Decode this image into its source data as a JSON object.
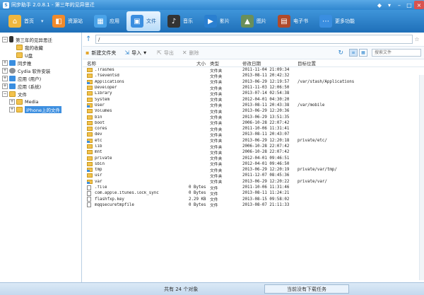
{
  "window": {
    "app_name": "同步助手 2.0.8.1",
    "device_title": "第三年的见异思迁"
  },
  "toolbar": {
    "items": [
      {
        "label": "首页",
        "icon": "home-icon",
        "color": "#f0b73f"
      },
      {
        "label": "资源站",
        "icon": "store-icon",
        "color": "#f08a2c"
      },
      {
        "label": "应用",
        "icon": "apps-icon",
        "color": "#4aa3e8"
      },
      {
        "label": "文件",
        "icon": "folder-icon",
        "color": "#3a8ee0"
      },
      {
        "label": "音乐",
        "icon": "music-icon",
        "color": "#333333"
      },
      {
        "label": "影片",
        "icon": "video-icon",
        "color": "#2a7fd0"
      },
      {
        "label": "图片",
        "icon": "picture-icon",
        "color": "#6a8f5a"
      },
      {
        "label": "电子书",
        "icon": "ebook-icon",
        "color": "#b04a2a"
      },
      {
        "label": "更多功能",
        "icon": "more-icon",
        "color": "#3a8ee0"
      }
    ],
    "active_index": 3
  },
  "sidebar": {
    "items": [
      {
        "label": "第三年的见异思迁",
        "level": 0,
        "expander": "−",
        "icon": "device"
      },
      {
        "label": "我的收藏",
        "level": 1,
        "expander": "",
        "icon": "folder"
      },
      {
        "label": "U盘",
        "level": 1,
        "expander": "",
        "icon": "folder"
      },
      {
        "label": "同步推",
        "level": 0,
        "expander": "+",
        "icon": "blue"
      },
      {
        "label": "Cydia 软件安装",
        "level": 0,
        "expander": "+",
        "icon": "gear"
      },
      {
        "label": "应用 (用户)",
        "level": 0,
        "expander": "+",
        "icon": "blue"
      },
      {
        "label": "应用 (系统)",
        "level": 0,
        "expander": "+",
        "icon": "blue"
      },
      {
        "label": "文件",
        "level": 0,
        "expander": "−",
        "icon": "folder"
      },
      {
        "label": "Media",
        "level": 1,
        "expander": "+",
        "icon": "folder"
      },
      {
        "label": "iPhone上的文件",
        "level": 1,
        "expander": "+",
        "icon": "folder",
        "selected": true
      }
    ]
  },
  "pathbar": {
    "path": "/"
  },
  "actions": {
    "new_folder": "新建文件夹",
    "import": "导入",
    "export": "导出",
    "delete": "删除",
    "search_placeholder": "搜索文件"
  },
  "table": {
    "headers": {
      "name": "名称",
      "size": "大小",
      "type": "类型",
      "date": "修改日期",
      "target": "目标位置"
    },
    "rows": [
      {
        "name": ".Trashes",
        "size": "",
        "type": "文件夹",
        "date": "2011-11-04 21:09:34",
        "target": "",
        "kind": "folder"
      },
      {
        "name": ".fseventsd",
        "size": "",
        "type": "文件夹",
        "date": "2013-08-11 20:42:32",
        "target": "",
        "kind": "folder"
      },
      {
        "name": "Applications",
        "size": "",
        "type": "文件夹",
        "date": "2013-06-29 12:19:57",
        "target": "/var/stash/Applications",
        "kind": "link"
      },
      {
        "name": "Developer",
        "size": "",
        "type": "文件夹",
        "date": "2011-11-03 12:06:50",
        "target": "",
        "kind": "folder"
      },
      {
        "name": "Library",
        "size": "",
        "type": "文件夹",
        "date": "2013-07-14 02:54:38",
        "target": "",
        "kind": "folder"
      },
      {
        "name": "System",
        "size": "",
        "type": "文件夹",
        "date": "2012-04-01 04:30:20",
        "target": "",
        "kind": "folder"
      },
      {
        "name": "User",
        "size": "",
        "type": "文件夹",
        "date": "2013-08-11 20:43:38",
        "target": "/var/mobile",
        "kind": "link"
      },
      {
        "name": "Volumes",
        "size": "",
        "type": "文件夹",
        "date": "2013-06-29 12:20:36",
        "target": "",
        "kind": "folder"
      },
      {
        "name": "bin",
        "size": "",
        "type": "文件夹",
        "date": "2013-06-29 13:51:35",
        "target": "",
        "kind": "folder"
      },
      {
        "name": "boot",
        "size": "",
        "type": "文件夹",
        "date": "2006-10-28 22:07:42",
        "target": "",
        "kind": "folder"
      },
      {
        "name": "cores",
        "size": "",
        "type": "文件夹",
        "date": "2011-10-06 11:31:41",
        "target": "",
        "kind": "folder"
      },
      {
        "name": "dev",
        "size": "",
        "type": "文件夹",
        "date": "2013-08-11 20:43:07",
        "target": "",
        "kind": "folder"
      },
      {
        "name": "etc",
        "size": "",
        "type": "文件夹",
        "date": "2013-06-29 12:20:18",
        "target": "private/etc/",
        "kind": "link"
      },
      {
        "name": "lib",
        "size": "",
        "type": "文件夹",
        "date": "2006-10-28 22:07:42",
        "target": "",
        "kind": "folder"
      },
      {
        "name": "mnt",
        "size": "",
        "type": "文件夹",
        "date": "2006-10-28 22:07:42",
        "target": "",
        "kind": "folder"
      },
      {
        "name": "private",
        "size": "",
        "type": "文件夹",
        "date": "2012-04-01 09:46:51",
        "target": "",
        "kind": "folder"
      },
      {
        "name": "sbin",
        "size": "",
        "type": "文件夹",
        "date": "2012-04-01 09:46:50",
        "target": "",
        "kind": "folder"
      },
      {
        "name": "tmp",
        "size": "",
        "type": "文件夹",
        "date": "2013-06-29 12:20:19",
        "target": "private/var/tmp/",
        "kind": "link"
      },
      {
        "name": "usr",
        "size": "",
        "type": "文件夹",
        "date": "2011-12-07 08:45:36",
        "target": "",
        "kind": "folder"
      },
      {
        "name": "var",
        "size": "",
        "type": "文件夹",
        "date": "2013-06-29 12:20:22",
        "target": "private/var/",
        "kind": "link"
      },
      {
        "name": ".file",
        "size": "0 Bytes",
        "type": "文件",
        "date": "2011-10-06 11:31:46",
        "target": "",
        "kind": "file"
      },
      {
        "name": "com.apple.itunes.lock_sync",
        "size": "0 Bytes",
        "type": "文件",
        "date": "2013-08-11 11:24:21",
        "target": "",
        "kind": "file"
      },
      {
        "name": "flashfxp.key",
        "size": "2.29 KB",
        "type": "文件",
        "date": "2013-08-15 09:58:02",
        "target": "",
        "kind": "file"
      },
      {
        "name": "mqqsecuretmpfile",
        "size": "0 Bytes",
        "type": "文件",
        "date": "2013-08-07 21:11:33",
        "target": "",
        "kind": "file"
      }
    ]
  },
  "status": {
    "count_text": "共有 24 个对象",
    "task_text": "当前没有下载任务"
  }
}
